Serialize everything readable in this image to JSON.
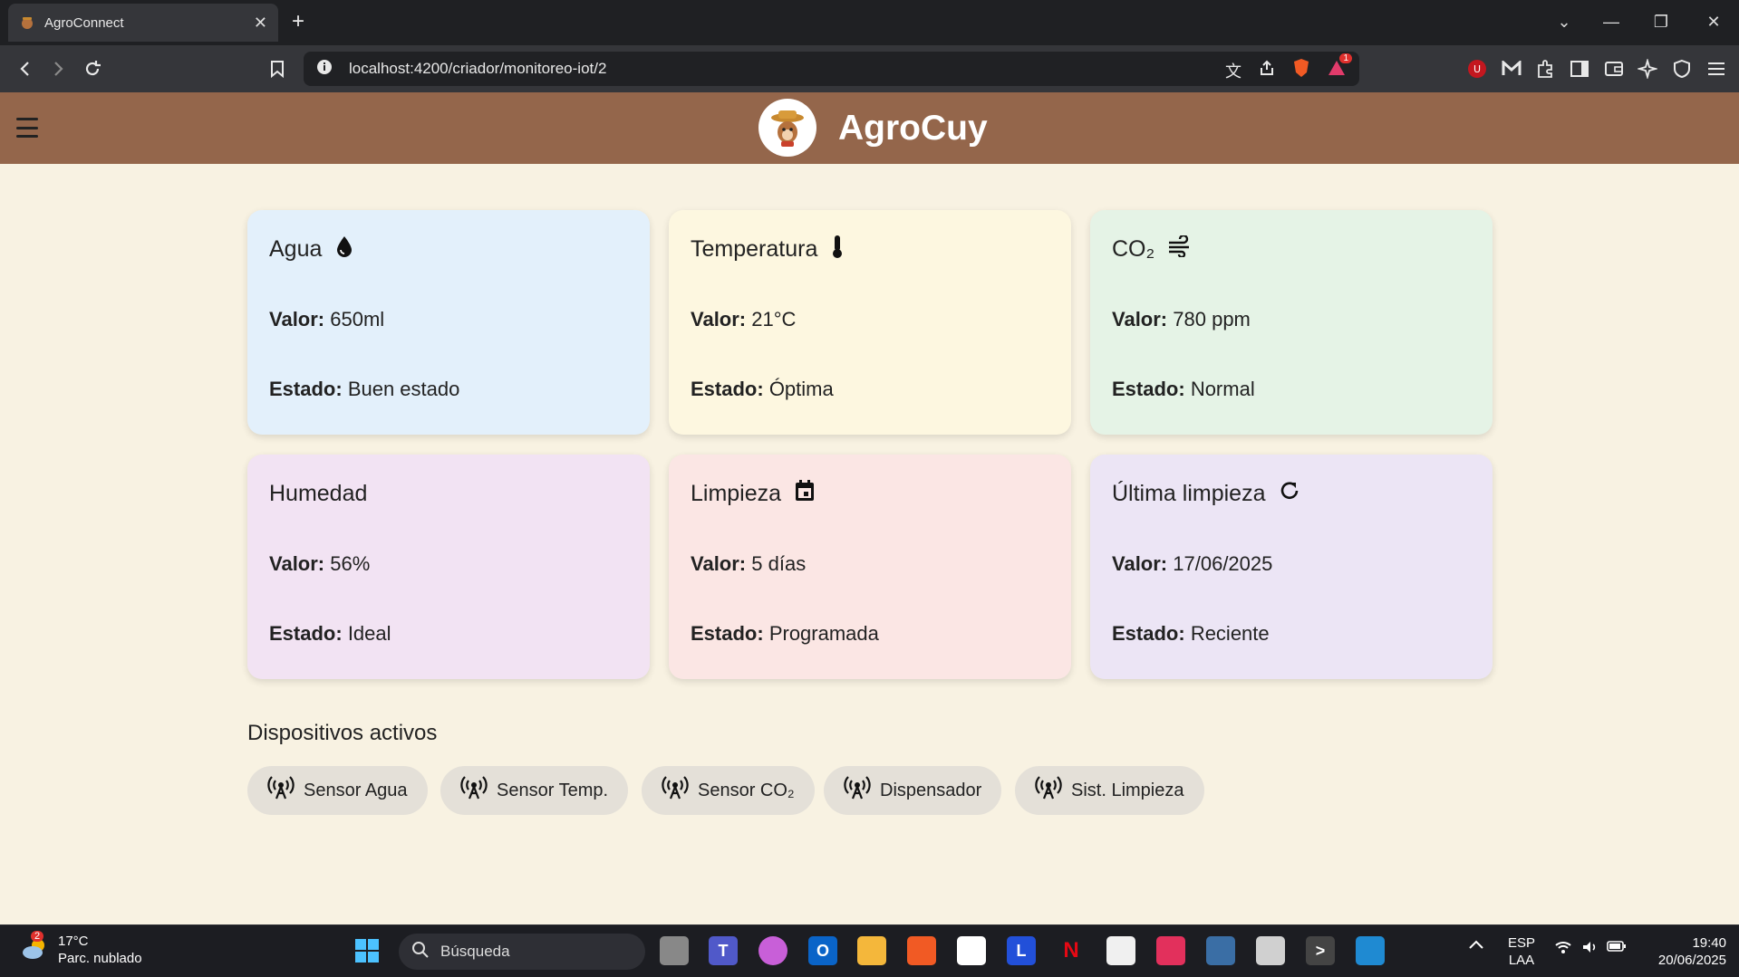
{
  "browser": {
    "tab_title": "AgroConnect",
    "url": "localhost:4200/criador/monitoreo-iot/2",
    "notification_count": "1"
  },
  "app": {
    "brand": "AgroCuy"
  },
  "cards": [
    {
      "title": "Agua",
      "value_label": "Valor:",
      "value": "650ml",
      "status_label": "Estado:",
      "status": "Buen estado",
      "color": "#e3f0fb",
      "icon": "water-drop-icon"
    },
    {
      "title": "Temperatura",
      "value_label": "Valor:",
      "value": "21°C",
      "status_label": "Estado:",
      "status": "Óptima",
      "color": "#fdf7e0",
      "icon": "thermometer-icon"
    },
    {
      "title": "CO₂",
      "value_label": "Valor:",
      "value": "780 ppm",
      "status_label": "Estado:",
      "status": "Normal",
      "color": "#e5f3e6",
      "icon": "wind-icon"
    },
    {
      "title": "Humedad",
      "value_label": "Valor:",
      "value": "56%",
      "status_label": "Estado:",
      "status": "Ideal",
      "color": "#f2e3f3",
      "icon": ""
    },
    {
      "title": "Limpieza",
      "value_label": "Valor:",
      "value": "5 días",
      "status_label": "Estado:",
      "status": "Programada",
      "color": "#fbe6e4",
      "icon": "calendar-icon"
    },
    {
      "title": "Última limpieza",
      "value_label": "Valor:",
      "value": "17/06/2025",
      "status_label": "Estado:",
      "status": "Reciente",
      "color": "#ece5f5",
      "icon": "refresh-icon"
    }
  ],
  "devices": {
    "title": "Dispositivos activos",
    "items": [
      "Sensor Agua",
      "Sensor Temp.",
      "Sensor CO₂",
      "Dispensador",
      "Sist. Limpieza"
    ]
  },
  "taskbar": {
    "weather_temp": "17°C",
    "weather_desc": "Parc. nublado",
    "weather_badge": "2",
    "search_placeholder": "Búsqueda",
    "lang_top": "ESP",
    "lang_bottom": "LAA",
    "time": "19:40",
    "date": "20/06/2025"
  }
}
